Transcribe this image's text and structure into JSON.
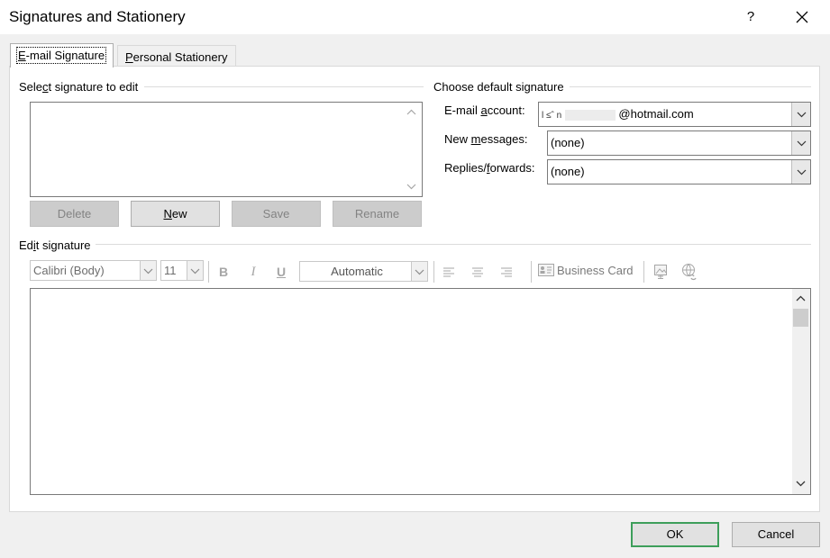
{
  "window": {
    "title": "Signatures and Stationery",
    "help": "?",
    "close": "✕"
  },
  "tabs": [
    {
      "pre": "",
      "key": "E",
      "post": "-mail Signature"
    },
    {
      "pre": "",
      "key": "P",
      "post": "ersonal Stationery"
    }
  ],
  "select_signature": {
    "label_pre": "Sele",
    "label_key": "c",
    "label_post": "t signature to edit",
    "buttons": {
      "delete": "Delete",
      "new_key": "N",
      "new_post": "ew",
      "save": "Save",
      "rename": "Rename"
    }
  },
  "default_signature": {
    "label": "Choose default signature",
    "email_account": {
      "label_pre": "E-mail ",
      "label_key": "a",
      "label_post": "ccount:",
      "value_prefix": "l ≤ˆ  n",
      "value_domain": "@hotmail.com"
    },
    "new_messages": {
      "label_pre": "New ",
      "label_key": "m",
      "label_post": "essages:",
      "value": "(none)"
    },
    "replies_forwards": {
      "label_pre": "Replies/",
      "label_key": "f",
      "label_post": "orwards:",
      "value": "(none)"
    }
  },
  "edit_signature": {
    "label_pre": "Ed",
    "label_key": "i",
    "label_post": "t signature",
    "toolbar": {
      "font": "Calibri (Body)",
      "size": "11",
      "bold": "B",
      "italic": "I",
      "underline": "U",
      "color": "Automatic",
      "business_card": "Business Card"
    }
  },
  "footer": {
    "ok": "OK",
    "cancel": "Cancel"
  },
  "colors": {
    "default_button_border": "#3d9e5a",
    "panel_bg": "#ffffff",
    "dialog_bg": "#f0f0f0"
  }
}
